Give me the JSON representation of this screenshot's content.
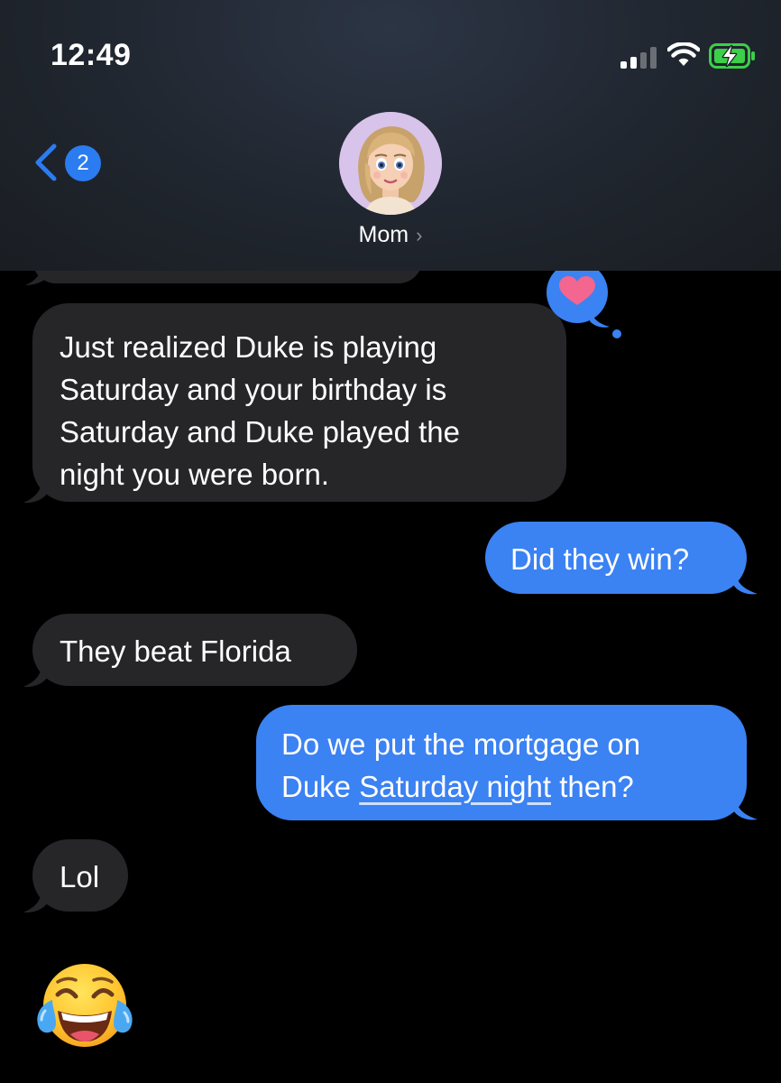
{
  "status_bar": {
    "time": "12:49",
    "signal_icon": "cellular-signal-icon",
    "wifi_icon": "wifi-icon",
    "battery_icon": "battery-charging-icon"
  },
  "header": {
    "back_icon": "chevron-left-icon",
    "unread_count": "2",
    "contact_name": "Mom",
    "contact_chevron": "›",
    "avatar_icon": "memoji-avatar-icon"
  },
  "messages": [
    {
      "direction": "received",
      "lines": [
        "Just realized Duke is playing",
        "Saturday and your birthday is",
        "Saturday and Duke played the",
        "night you were born."
      ],
      "tapback": "heart"
    },
    {
      "direction": "sent",
      "text": "Did they win?"
    },
    {
      "direction": "received",
      "text": "They beat Florida"
    },
    {
      "direction": "sent",
      "line1": "Do we put the mortgage on",
      "line2_prefix": "Duke ",
      "line2_link": "Saturday night",
      "line2_suffix": " then?"
    },
    {
      "direction": "received",
      "text": "Lol"
    },
    {
      "direction": "received",
      "emoji": "face-with-tears-of-joy"
    }
  ],
  "colors": {
    "sent_bubble": "#3b82f3",
    "received_bubble": "#262629",
    "background": "#000000",
    "accent": "#2b7cf0",
    "tapback_heart": "#f2668f"
  }
}
